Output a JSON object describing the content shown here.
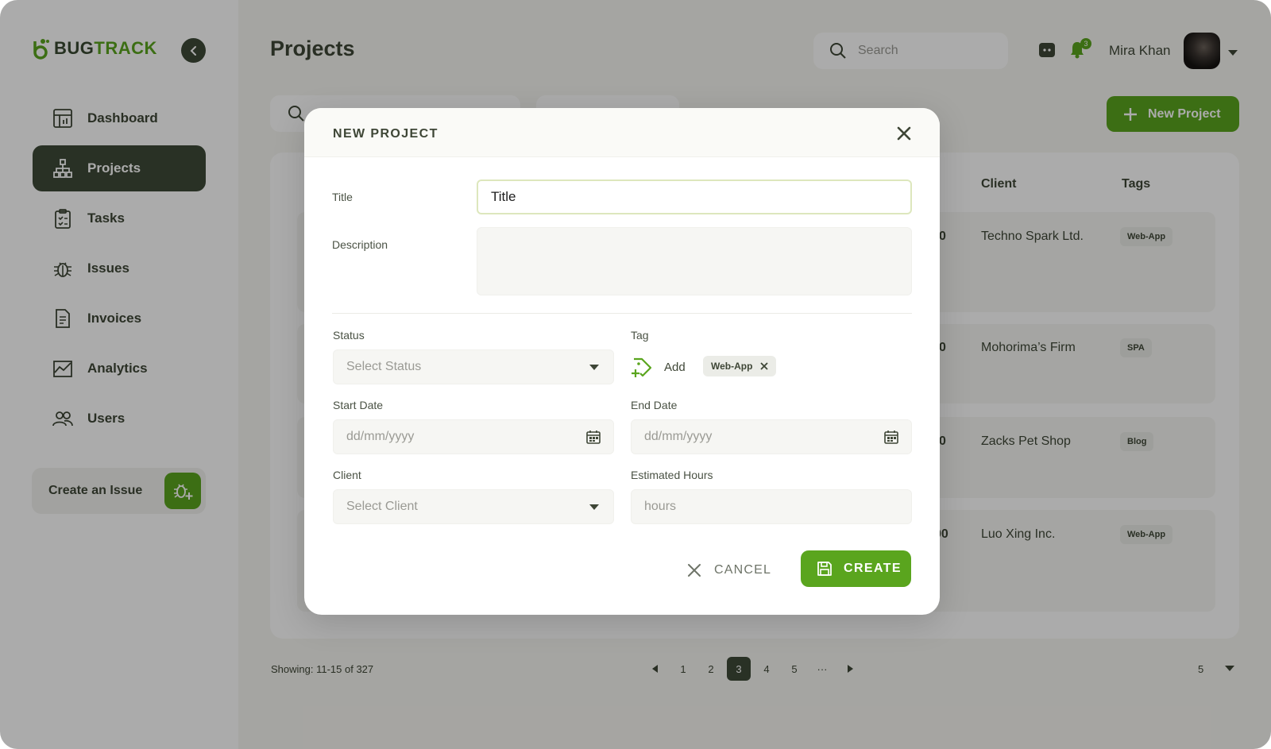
{
  "app": {
    "logo": {
      "part1": "BUG",
      "part2": "TRACK"
    },
    "colors": {
      "accent": "#5aa51e",
      "dark": "#3e4a38",
      "text": "#3e4636"
    }
  },
  "sidebar": {
    "items": [
      {
        "label": "Dashboard",
        "icon": "dashboard-icon",
        "active": false
      },
      {
        "label": "Projects",
        "icon": "hierarchy-icon",
        "active": true
      },
      {
        "label": "Tasks",
        "icon": "clipboard-icon",
        "active": false
      },
      {
        "label": "Issues",
        "icon": "bug-icon",
        "active": false
      },
      {
        "label": "Invoices",
        "icon": "document-icon",
        "active": false
      },
      {
        "label": "Analytics",
        "icon": "chart-icon",
        "active": false
      },
      {
        "label": "Users",
        "icon": "users-icon",
        "active": false
      }
    ],
    "create_issue": "Create an Issue"
  },
  "header": {
    "title": "Projects",
    "search_placeholder": "Search",
    "notifications_count": "3",
    "user_name": "Mira Khan"
  },
  "toolbar": {
    "new_project_label": "New Project"
  },
  "table": {
    "headers": {
      "client": "Client",
      "tags": "Tags"
    },
    "rows": [
      {
        "num": "0",
        "client": "Techno Spark Ltd.",
        "tag": "Web-App"
      },
      {
        "num": "0",
        "client": "Mohorima’s Firm",
        "tag": "SPA"
      },
      {
        "num": "0",
        "client": "Zacks Pet Shop",
        "tag": "Blog"
      },
      {
        "num": "00",
        "client": "Luo Xing Inc.",
        "tag": "Web-App"
      }
    ]
  },
  "pagination": {
    "showing": "Showing: 11-15 of 327",
    "pages": [
      "1",
      "2",
      "3",
      "4",
      "5",
      "···"
    ],
    "active_page": "3",
    "per_page": "5"
  },
  "modal": {
    "title": "NEW PROJECT",
    "fields": {
      "title_label": "Title",
      "title_value": "Title",
      "description_label": "Description",
      "status_label": "Status",
      "status_placeholder": "Select Status",
      "tag_label": "Tag",
      "tag_add": "Add",
      "tag_chip": "Web-App",
      "start_date_label": "Start Date",
      "start_date_placeholder": "dd/mm/yyyy",
      "end_date_label": "End Date",
      "end_date_placeholder": "dd/mm/yyyy",
      "client_label": "Client",
      "client_placeholder": "Select Client",
      "hours_label": "Estimated Hours",
      "hours_placeholder": "hours"
    },
    "cancel_label": "CANCEL",
    "create_label": "CREATE"
  }
}
